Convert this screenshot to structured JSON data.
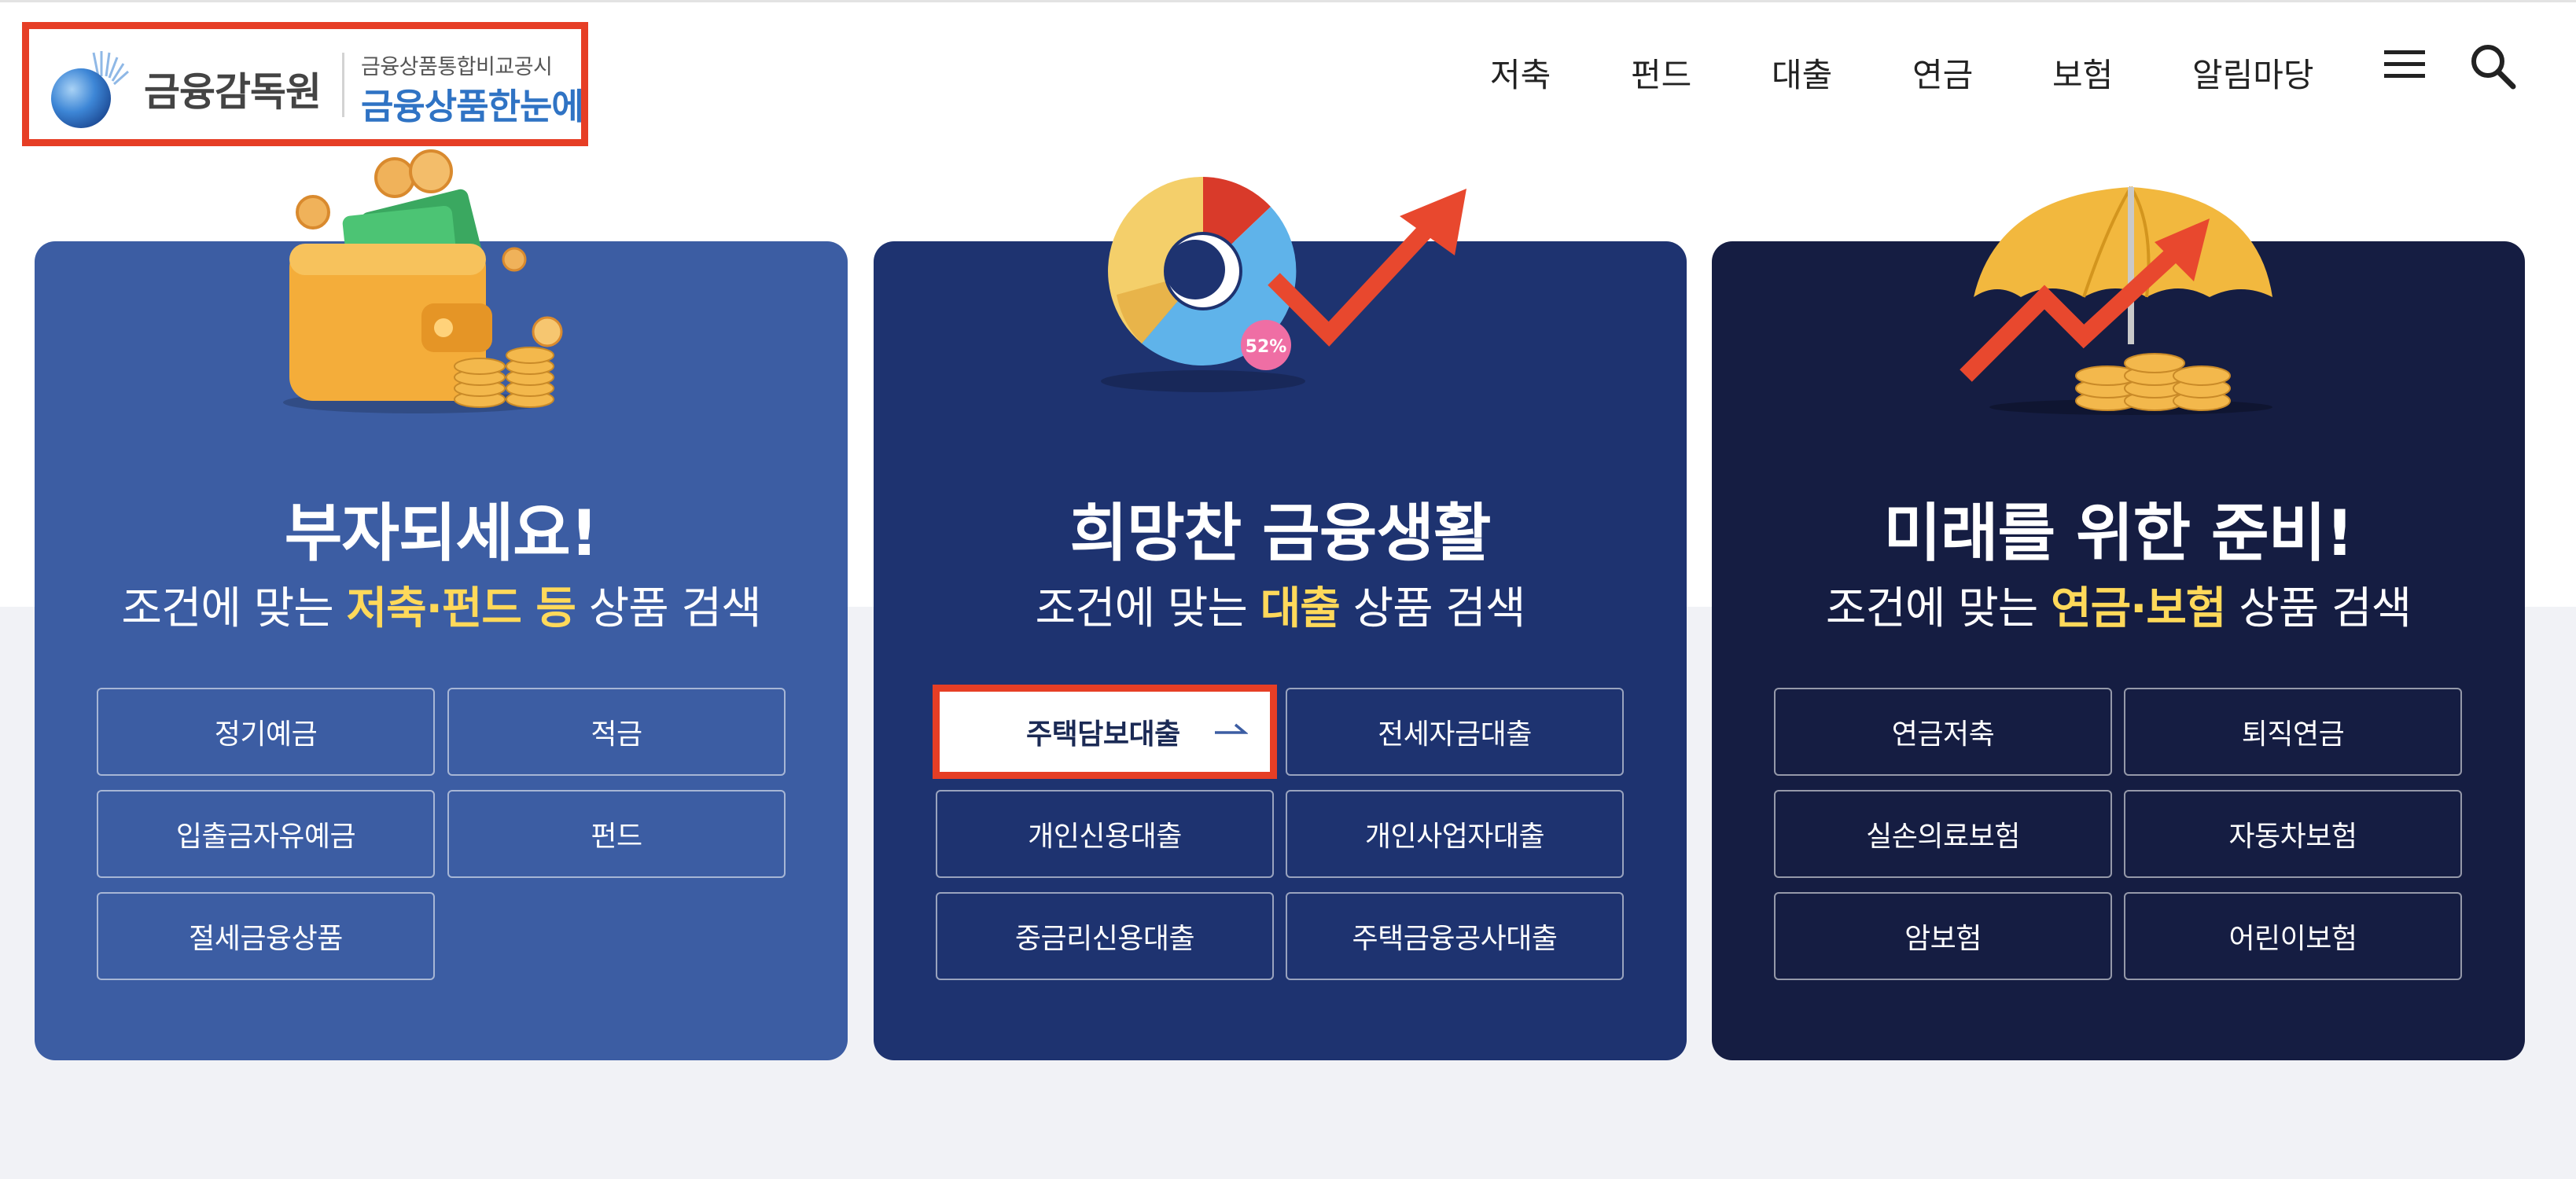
{
  "header": {
    "org_name": "금융감독원",
    "logo_sub": "금융상품통합비교공시",
    "logo_main": "금융상품한눈에",
    "nav": [
      {
        "label": "저축"
      },
      {
        "label": "펀드"
      },
      {
        "label": "대출"
      },
      {
        "label": "연금"
      },
      {
        "label": "보험"
      },
      {
        "label": "알림마당"
      }
    ],
    "icons": {
      "menu": "hamburger-menu-icon",
      "search": "search-icon"
    }
  },
  "cards": [
    {
      "title": "부자되세요!",
      "sub_prefix": "조건에 맞는 ",
      "sub_highlight": "저축·펀드 등",
      "sub_suffix": " 상품 검색",
      "bg": "#3c5da3",
      "illustration": "wallet-coins-icon",
      "buttons": [
        "정기예금",
        "적금",
        "입출금자유예금",
        "펀드",
        "절세금융상품"
      ]
    },
    {
      "title": "희망찬 금융생활",
      "sub_prefix": "조건에 맞는 ",
      "sub_highlight": "대출",
      "sub_suffix": " 상품 검색",
      "bg": "#1e3370",
      "illustration": "pie-chart-growth-icon",
      "pie_badge": "52%",
      "buttons": [
        "주택담보대출",
        "전세자금대출",
        "개인신용대출",
        "개인사업자대출",
        "중금리신용대출",
        "주택금융공사대출"
      ],
      "active_button": 0
    },
    {
      "title": "미래를 위한 준비!",
      "sub_prefix": "조건에 맞는 ",
      "sub_highlight": "연금·보험",
      "sub_suffix": " 상품 검색",
      "bg": "#151d42",
      "illustration": "umbrella-coins-icon",
      "buttons": [
        "연금저축",
        "퇴직연금",
        "실손의료보험",
        "자동차보험",
        "암보험",
        "어린이보험"
      ]
    }
  ],
  "colors": {
    "highlight": "#ffd95a",
    "annotation": "#e63e25",
    "logo_blue": "#2f73c4"
  }
}
